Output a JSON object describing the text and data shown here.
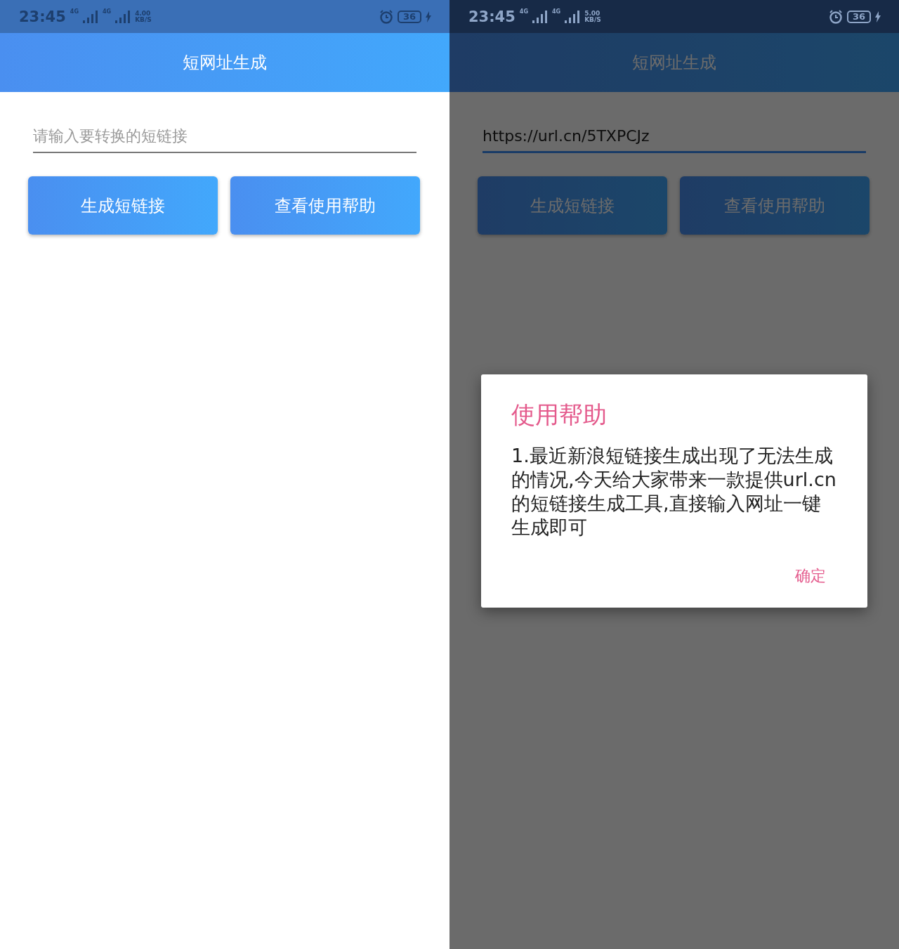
{
  "screens": [
    {
      "status_bar": {
        "time": "23:45",
        "network_1": "4G",
        "network_2": "4G",
        "speed": "4.00",
        "speed_unit": "KB/S",
        "battery": "36"
      },
      "title": "短网址生成",
      "field": {
        "placeholder": "请输入要转换的短链接",
        "focused": false
      },
      "buttons": [
        "生成短链接",
        "查看使用帮助"
      ]
    },
    {
      "status_bar": {
        "time": "23:45",
        "network_1": "4G",
        "network_2": "4G",
        "speed": "5.00",
        "speed_unit": "KB/S",
        "battery": "36"
      },
      "title": "短网址生成",
      "field": {
        "value": "https://url.cn/5TXPCJz",
        "focused": true
      },
      "buttons": [
        "生成短链接",
        "查看使用帮助"
      ],
      "dialog": {
        "title": "使用帮助",
        "body": "1.最近新浪短链接生成出现了无法生成的情况,今天给大家带来一款提供url.cn的短链接生成工具,直接输入网址一键生成即可",
        "button": "确定"
      }
    }
  ]
}
